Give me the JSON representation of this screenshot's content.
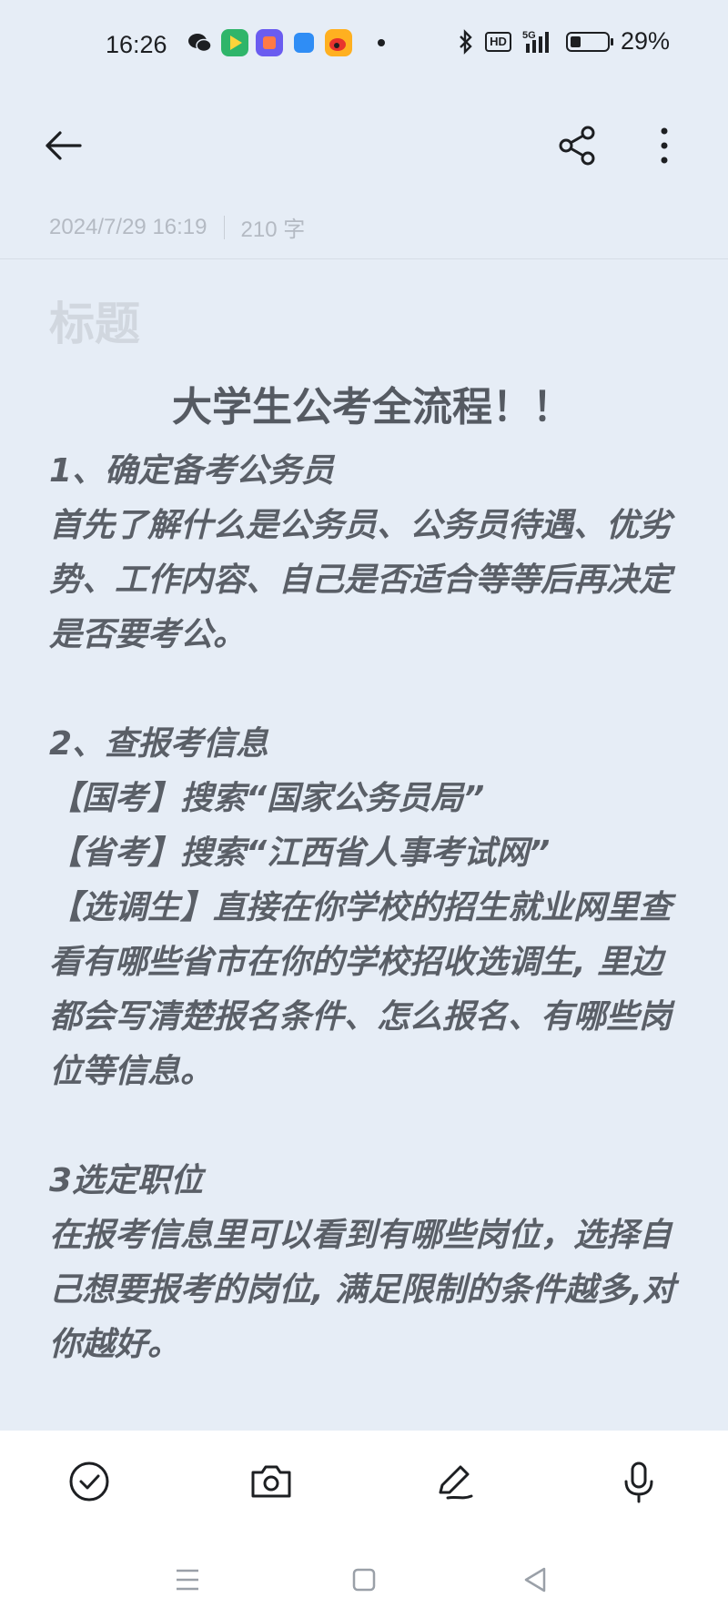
{
  "status_bar": {
    "time": "16:26",
    "battery": "29%",
    "battery_level": 0.29,
    "network": "5G",
    "hd_label": "HD",
    "app_icons": [
      "wechat-icon",
      "video-app-icon",
      "office-app-icon",
      "blue-app-icon",
      "weibo-icon"
    ]
  },
  "toolbar": {
    "back_icon": "arrow-left-icon",
    "share_icon": "share-icon",
    "more_icon": "more-vertical-icon"
  },
  "meta": {
    "datetime": "2024/7/29 16:19",
    "word_count": "210 字"
  },
  "title_placeholder": "标题",
  "note": {
    "heading": "大学生公考全流程！！",
    "lines": [
      "1、确定备考公务员",
      "首先了解什么是公务员、公务员待遇、优劣",
      "势、工作内容、自己是否适合等等后再决定",
      "是否要考公。",
      "",
      "2、查报考信息",
      "【国考】搜索“国家公务员局”",
      "【省考】搜索“江西省人事考试网”",
      "【选调生】直接在你学校的招生就业网里查",
      "看有哪些省市在你的学校招收选调生, 里边",
      "都会写清楚报名条件、怎么报名、有哪些岗",
      "位等信息。",
      "",
      "3选定职位",
      "在报考信息里可以看到有哪些岗位，选择自",
      "己想要报考的岗位, 满足限制的条件越多,对",
      "你越好。"
    ]
  },
  "bottom_bar": {
    "items": [
      "checklist-icon",
      "camera-icon",
      "handwriting-icon",
      "microphone-icon"
    ]
  },
  "nav": {
    "items": [
      "menu-icon",
      "home-icon",
      "back-triangle-icon"
    ]
  },
  "colors": {
    "background": "#e6edf6",
    "text": "#555a62",
    "muted": "#b4bac3",
    "bottom_bar": "#ffffff"
  }
}
